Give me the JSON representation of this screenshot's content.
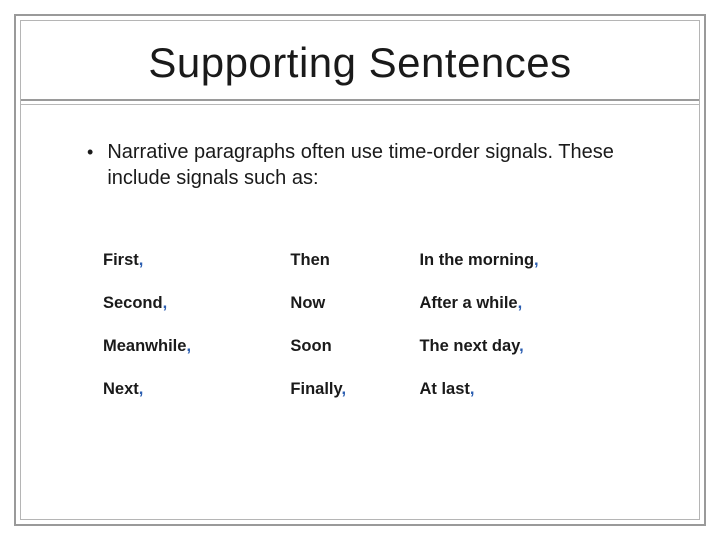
{
  "title": "Supporting Sentences",
  "bullet": {
    "text": "Narrative paragraphs often use time-order signals. These include signals such as:"
  },
  "signals": {
    "rows": [
      {
        "c0_word": "First",
        "c0_comma": ",",
        "c1_word": "Then",
        "c1_comma": "",
        "c2_word": "In the morning",
        "c2_comma": ","
      },
      {
        "c0_word": "Second",
        "c0_comma": ",",
        "c1_word": "Now",
        "c1_comma": "",
        "c2_word": "After a while",
        "c2_comma": ","
      },
      {
        "c0_word": "Meanwhile",
        "c0_comma": ",",
        "c1_word": "Soon",
        "c1_comma": "",
        "c2_word": "The next day",
        "c2_comma": ","
      },
      {
        "c0_word": "Next",
        "c0_comma": ",",
        "c1_word": "Finally",
        "c1_comma": ",",
        "c2_word": "At last",
        "c2_comma": ","
      }
    ]
  }
}
